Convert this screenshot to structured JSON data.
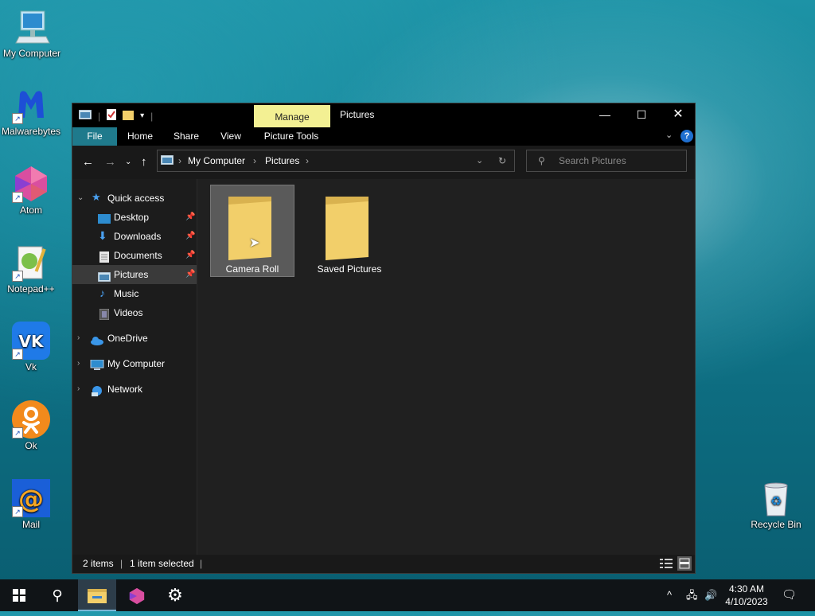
{
  "desktop": {
    "icons": [
      {
        "label": "My Computer"
      },
      {
        "label": "Malwarebytes"
      },
      {
        "label": "Atom"
      },
      {
        "label": "Notepad++"
      },
      {
        "label": "Vk"
      },
      {
        "label": "Ok"
      },
      {
        "label": "Mail"
      },
      {
        "label": "Recycle Bin"
      }
    ]
  },
  "window": {
    "title": "Pictures",
    "contextual_tab": "Manage",
    "ribbon_tabs": [
      "File",
      "Home",
      "Share",
      "View",
      "Picture Tools"
    ],
    "address": {
      "crumbs": [
        "My Computer",
        "Pictures"
      ]
    },
    "search_placeholder": "Search Pictures",
    "nav": {
      "quick_access": "Quick access",
      "items": [
        "Desktop",
        "Downloads",
        "Documents",
        "Pictures",
        "Music",
        "Videos"
      ],
      "selected": "Pictures",
      "roots": [
        "OneDrive",
        "My Computer",
        "Network"
      ]
    },
    "folders": [
      {
        "name": "Camera Roll",
        "selected": true
      },
      {
        "name": "Saved Pictures",
        "selected": false
      }
    ],
    "status": {
      "count": "2 items",
      "selection": "1 item selected"
    }
  },
  "taskbar": {
    "time": "4:30 AM",
    "date": "4/10/2023"
  },
  "colors": {
    "accent": "#1f7a8c",
    "manage_tab": "#f3f093",
    "folder": "#f2cf6a"
  }
}
